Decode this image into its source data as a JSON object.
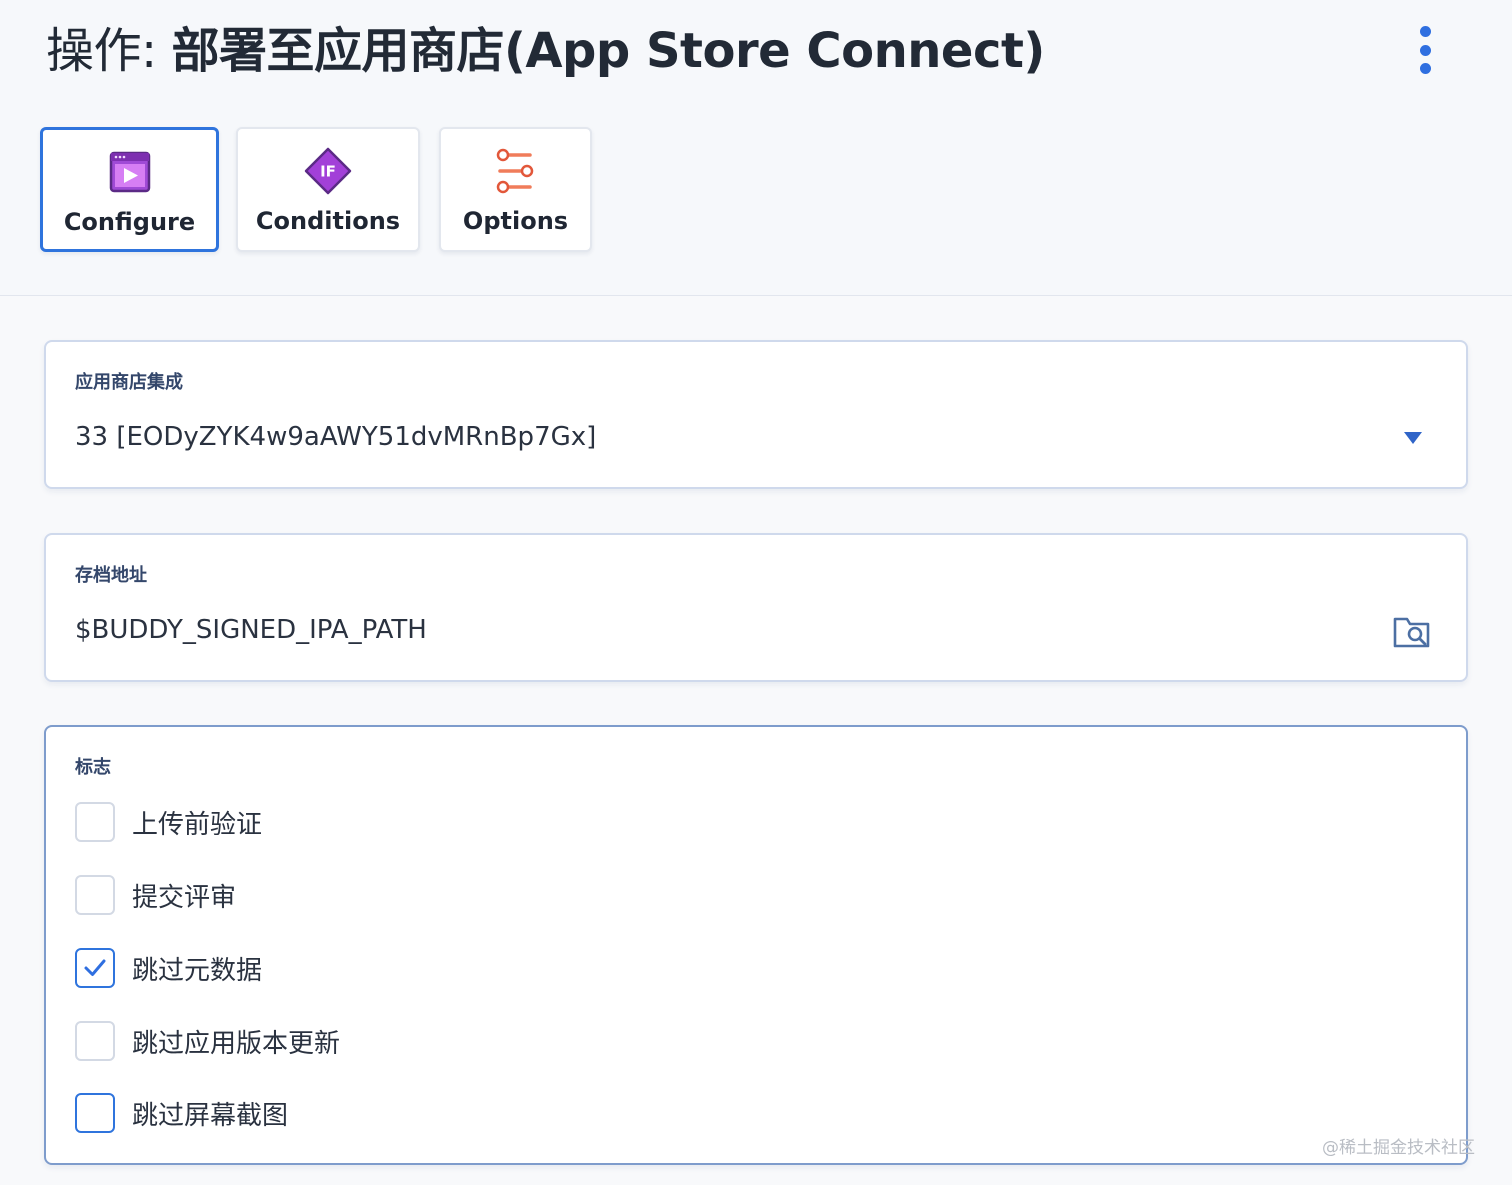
{
  "header": {
    "title_prefix": "操作: ",
    "title_name": "部署至应用商店(App Store Connect)",
    "more_icon": "more-vertical-icon"
  },
  "tabs": [
    {
      "label": "Configure",
      "icon": "play-window-icon",
      "active": true
    },
    {
      "label": "Conditions",
      "icon": "if-diamond-icon",
      "active": false
    },
    {
      "label": "Options",
      "icon": "sliders-icon",
      "active": false
    }
  ],
  "integration": {
    "label": "应用商店集成",
    "value": "33 [EODyZYK4w9aAWY51dvMRnBp7Gx]",
    "icon": "dropdown-caret-icon"
  },
  "archive": {
    "label": "存档地址",
    "value": "$BUDDY_SIGNED_IPA_PATH",
    "icon": "folder-search-icon"
  },
  "flags": {
    "label": "标志",
    "items": [
      {
        "label": "上传前验证",
        "checked": false
      },
      {
        "label": "提交评审",
        "checked": false
      },
      {
        "label": "跳过元数据",
        "checked": true
      },
      {
        "label": "跳过应用版本更新",
        "checked": false
      },
      {
        "label": "跳过屏幕截图",
        "checked": false
      }
    ]
  },
  "watermark": "@稀土掘金技术社区",
  "colors": {
    "accent": "#2f74dd",
    "purple": "#a440d8",
    "orange": "#f07c5a"
  }
}
